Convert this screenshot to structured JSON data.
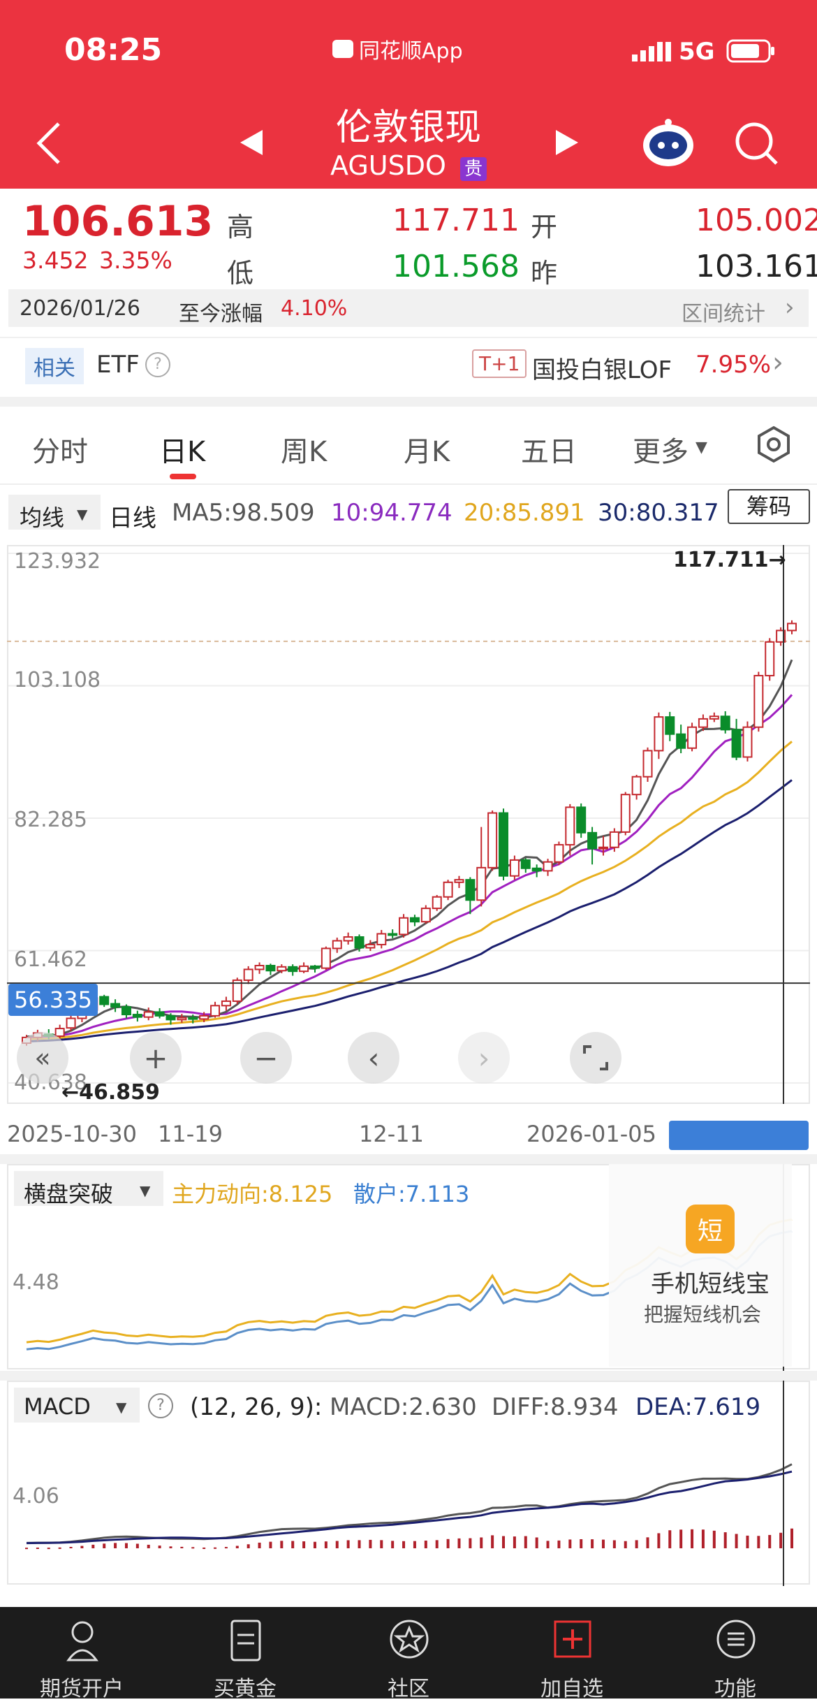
{
  "status_bar": {
    "time": "08:25",
    "app": "同花顺App",
    "network": "5G"
  },
  "header": {
    "title": "伦敦银现",
    "code": "AGUSDO",
    "badge": "贵"
  },
  "quote": {
    "price": "106.613",
    "change": "3.452",
    "change_pct": "3.35%",
    "high_label": "高",
    "high": "117.711",
    "low_label": "低",
    "low": "101.568",
    "open_label": "开",
    "open": "105.002",
    "prev_label": "昨",
    "prev": "103.161"
  },
  "range_bar": {
    "date": "2026/01/26",
    "label": "至今涨幅",
    "value": "4.10%",
    "stat": "区间统计"
  },
  "related": {
    "tag": "相关",
    "etf": "ETF",
    "t1": "T+1",
    "fund": "国投白银LOF",
    "fund_pct": "7.95%"
  },
  "tabs": [
    "分时",
    "日K",
    "周K",
    "月K",
    "五日",
    "更多"
  ],
  "active_tab": "日K",
  "ma_bar": {
    "selector": "均线",
    "period": "日线",
    "ma5": "MA5:98.509",
    "ma10": "10:94.774",
    "ma20": "20:85.891",
    "ma30": "30:80.317",
    "chips": "筹码"
  },
  "kchart": {
    "y_labels": [
      "123.932",
      "103.108",
      "82.285",
      "61.462",
      "40.638"
    ],
    "crosshair_value": "56.335",
    "high_marker": "117.711→",
    "low_marker": "←46.859",
    "x_labels": [
      "2025-10-30",
      "11-19",
      "12-11",
      "2026-01-05"
    ]
  },
  "indicator1": {
    "selector": "横盘突破",
    "main": "主力动向:8.125",
    "retail": "散户:7.113",
    "y_label": "4.48",
    "ad_title": "手机短线宝",
    "ad_sub": "把握短线机会",
    "ad_icon": "短"
  },
  "macd": {
    "selector": "MACD",
    "params": "(12, 26, 9):",
    "macd": "MACD:2.630",
    "diff": "DIFF:8.934",
    "dea": "DEA:7.619",
    "y_label": "4.06"
  },
  "bottom_nav": [
    "期货开户",
    "买黄金",
    "社区",
    "加自选",
    "功能"
  ],
  "chart_data": {
    "type": "candlestick",
    "title": "伦敦银现 日K",
    "ylim": [
      40.638,
      123.932
    ],
    "x_ticks": [
      "2025-10-30",
      "11-19",
      "12-11",
      "2026-01-05"
    ],
    "candles": [
      [
        46.9,
        47.8,
        46.5,
        48.2
      ],
      [
        47.8,
        48.5,
        47.2,
        49.0
      ],
      [
        48.3,
        48.0,
        47.5,
        49.1
      ],
      [
        48.0,
        49.2,
        47.6,
        49.8
      ],
      [
        49.3,
        50.8,
        48.8,
        51.2
      ],
      [
        50.8,
        52.3,
        50.2,
        53.0
      ],
      [
        52.1,
        54.0,
        51.5,
        55.0
      ],
      [
        54.2,
        53.0,
        52.6,
        54.5
      ],
      [
        53.1,
        52.6,
        51.8,
        53.8
      ],
      [
        52.6,
        51.4,
        50.8,
        53.0
      ],
      [
        51.4,
        51.0,
        50.3,
        52.0
      ],
      [
        51.0,
        51.8,
        50.5,
        52.5
      ],
      [
        51.8,
        51.2,
        50.8,
        52.4
      ],
      [
        51.2,
        50.6,
        49.8,
        51.6
      ],
      [
        50.6,
        50.9,
        50.1,
        51.5
      ],
      [
        50.9,
        50.7,
        50.0,
        51.4
      ],
      [
        50.7,
        51.2,
        50.2,
        51.8
      ],
      [
        51.2,
        52.8,
        50.9,
        53.4
      ],
      [
        52.8,
        53.5,
        52.0,
        54.2
      ],
      [
        53.5,
        56.8,
        53.0,
        57.2
      ],
      [
        56.8,
        58.5,
        56.2,
        59.0
      ],
      [
        58.5,
        59.1,
        57.8,
        59.6
      ],
      [
        59.1,
        58.3,
        57.6,
        59.4
      ],
      [
        58.3,
        58.9,
        57.9,
        59.3
      ],
      [
        58.9,
        58.2,
        57.5,
        59.3
      ],
      [
        58.2,
        59.0,
        57.9,
        59.6
      ],
      [
        59.0,
        58.7,
        58.0,
        59.2
      ],
      [
        58.7,
        61.8,
        58.4,
        62.1
      ],
      [
        61.8,
        63.0,
        61.1,
        63.5
      ],
      [
        63.0,
        63.6,
        62.4,
        64.3
      ],
      [
        63.6,
        61.9,
        61.3,
        64.0
      ],
      [
        61.9,
        62.4,
        61.4,
        63.1
      ],
      [
        62.4,
        64.1,
        61.8,
        64.7
      ],
      [
        64.1,
        64.0,
        63.4,
        64.8
      ],
      [
        64.0,
        66.6,
        63.5,
        67.2
      ],
      [
        66.6,
        66.0,
        65.3,
        67.1
      ],
      [
        66.0,
        68.1,
        65.7,
        68.6
      ],
      [
        68.1,
        69.9,
        67.7,
        70.2
      ],
      [
        69.9,
        72.2,
        69.4,
        72.6
      ],
      [
        72.2,
        72.6,
        71.3,
        73.2
      ],
      [
        72.6,
        69.4,
        67.2,
        73.0
      ],
      [
        69.4,
        74.5,
        68.4,
        80.9
      ],
      [
        74.5,
        83.1,
        74.0,
        83.5
      ],
      [
        83.1,
        73.2,
        72.5,
        83.8
      ],
      [
        73.2,
        75.7,
        72.6,
        76.4
      ],
      [
        75.7,
        74.4,
        73.7,
        76.0
      ],
      [
        74.4,
        74.0,
        73.0,
        75.0
      ],
      [
        74.0,
        75.4,
        73.2,
        75.9
      ],
      [
        75.4,
        78.1,
        74.9,
        78.6
      ],
      [
        78.1,
        84.0,
        76.4,
        84.5
      ],
      [
        84.0,
        80.0,
        79.2,
        84.6
      ],
      [
        80.0,
        77.5,
        75.0,
        80.9
      ],
      [
        77.5,
        77.7,
        76.4,
        79.5
      ],
      [
        77.7,
        80.1,
        77.0,
        80.7
      ],
      [
        80.1,
        86.0,
        79.6,
        86.4
      ],
      [
        86.0,
        88.8,
        85.2,
        89.1
      ],
      [
        88.8,
        92.9,
        88.0,
        93.4
      ],
      [
        92.9,
        98.2,
        91.6,
        98.9
      ],
      [
        98.2,
        95.5,
        94.4,
        99.0
      ],
      [
        95.5,
        93.3,
        92.5,
        97.0
      ],
      [
        93.3,
        96.6,
        92.8,
        97.3
      ],
      [
        96.6,
        97.9,
        96.0,
        98.6
      ],
      [
        97.9,
        98.3,
        97.4,
        98.9
      ],
      [
        98.3,
        96.2,
        95.6,
        99.1
      ],
      [
        96.2,
        91.9,
        91.4,
        97.9
      ],
      [
        91.9,
        96.6,
        91.2,
        97.5
      ],
      [
        96.6,
        104.7,
        95.9,
        105.3
      ],
      [
        104.7,
        110.0,
        103.9,
        110.6
      ],
      [
        110.0,
        111.8,
        109.4,
        112.3
      ],
      [
        111.8,
        112.9,
        111.2,
        113.4
      ]
    ],
    "series": [
      {
        "name": "MA5",
        "last": 98.509
      },
      {
        "name": "MA10",
        "last": 94.774
      },
      {
        "name": "MA20",
        "last": 85.891
      },
      {
        "name": "MA30",
        "last": 80.317
      }
    ],
    "reference_line": 110.1
  },
  "colors": {
    "header_red": "#eb3340",
    "up": "#c4282e",
    "down": "#0a8c2a",
    "ma5": "#555555",
    "ma10": "#a020c0",
    "ma20": "#e8b020",
    "ma30": "#1b1f6e"
  }
}
